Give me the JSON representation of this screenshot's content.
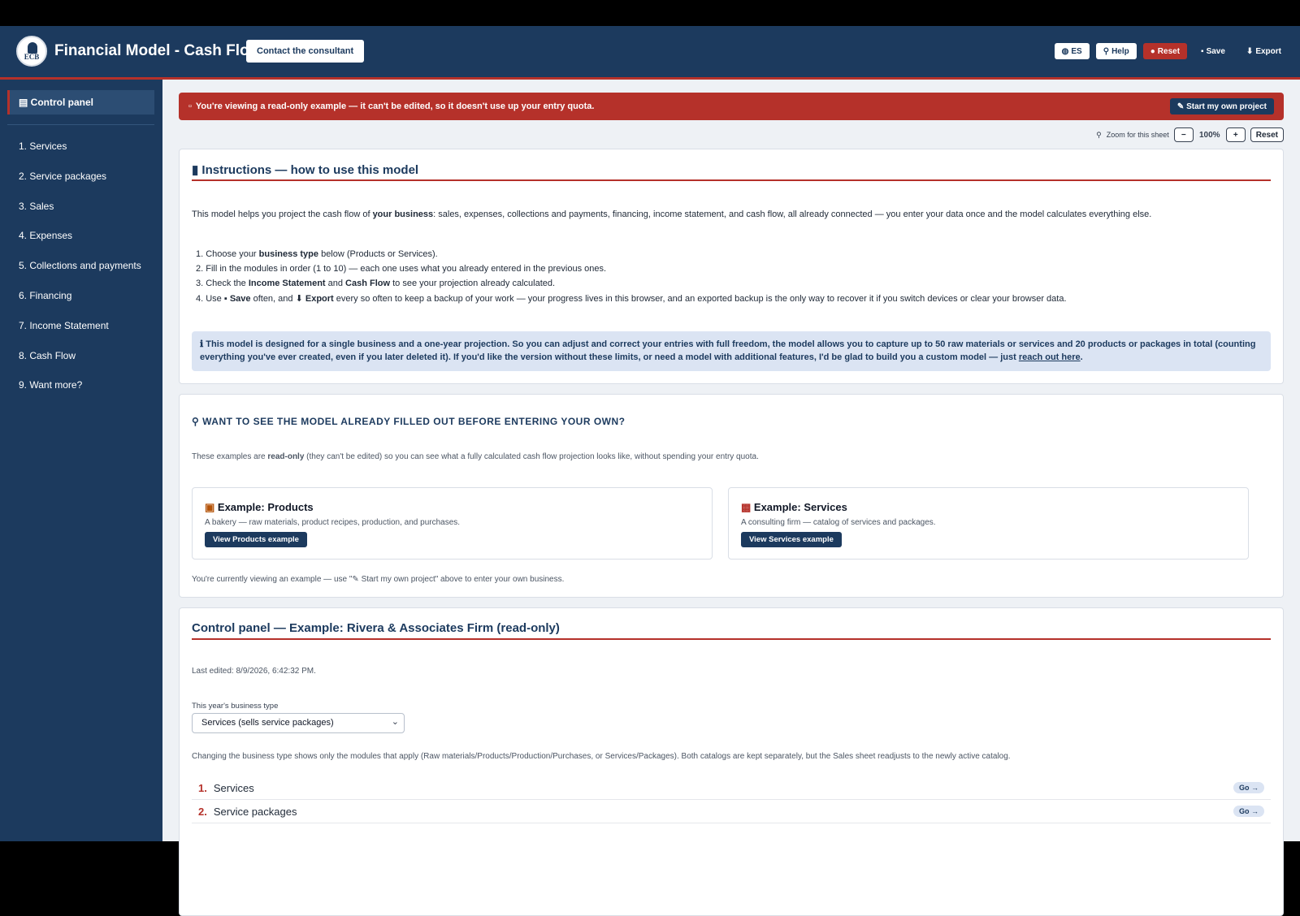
{
  "header": {
    "title": "Financial Model - Cash Flow",
    "logo_text": "ECB",
    "consult_label": "Contact the consultant",
    "lang_label": "ES",
    "help_label": "Help",
    "reset_label": "Reset",
    "save_label": "Save",
    "export_label": "Export"
  },
  "sidebar": {
    "active": "Control panel",
    "items": [
      {
        "label": "1. Services"
      },
      {
        "label": "2. Service packages"
      },
      {
        "label": "3. Sales"
      },
      {
        "label": "4. Expenses"
      },
      {
        "label": "5. Collections and payments"
      },
      {
        "label": "6. Financing"
      },
      {
        "label": "7. Income Statement"
      },
      {
        "label": "8. Cash Flow"
      },
      {
        "label": "9. Want more?"
      }
    ]
  },
  "banner": {
    "text": "You're viewing a read-only example — it can't be edited, so it doesn't use up your entry quota.",
    "start_label": "Start my own project"
  },
  "zoom": {
    "label": "Zoom for this sheet",
    "minus": "−",
    "value": "100%",
    "plus": "+",
    "reset": "Reset"
  },
  "instructions": {
    "title": "Instructions — how to use this model",
    "intro_1": "This model helps you project the cash flow of ",
    "intro_bold": "your business",
    "intro_2": ": sales, expenses, collections and payments, financing, income statement, and cash flow, all already connected — you enter your data once and the model calculates everything else.",
    "s1_a": "1. Choose your ",
    "s1_b": "business type",
    "s1_c": " below (Products or Services).",
    "s2": "2. Fill in the modules in order (1 to 10) — each one uses what you already entered in the previous ones.",
    "s3_a": "3. Check the ",
    "s3_b": "Income Statement",
    "s3_c": " and ",
    "s3_d": "Cash Flow",
    "s3_e": " to see your projection already calculated.",
    "s4_a": "4. Use ",
    "s4_b": "Save",
    "s4_c": " often, and ",
    "s4_d": "Export",
    "s4_e": " every so often to keep a backup of your work — your progress lives in this browser, and an exported backup is the only way to recover it if you switch devices or clear your browser data.",
    "info_1": "This model is designed for a single business and a one-year projection. So you can adjust and correct your entries with full freedom, the model allows you to capture up to 50 raw materials or services and 20 products or packages in total (counting everything you've ever created, even if you later deleted it). If you'd like the version without these limits, or need a model with additional features, I'd be glad to build you a custom model — just ",
    "info_link": "reach out here",
    "info_end": "."
  },
  "examples": {
    "title": "WANT TO SEE THE MODEL ALREADY FILLED OUT BEFORE ENTERING YOUR OWN?",
    "desc_1": "These examples are ",
    "desc_bold": "read-only",
    "desc_2": " (they can't be edited) so you can see what a fully calculated cash flow projection looks like, without spending your entry quota.",
    "products": {
      "title": "Example: Products",
      "desc": "A bakery — raw materials, product recipes, production, and purchases.",
      "button": "View Products example"
    },
    "services": {
      "title": "Example: Services",
      "desc": "A consulting firm — catalog of services and packages.",
      "button": "View Services example"
    },
    "note_1": "You're currently viewing an example — use \"",
    "note_2": " Start my own project\" above to enter your own business."
  },
  "control": {
    "title": "Control panel — Example: Rivera & Associates Firm (read-only)",
    "last_edited": "Last edited: 8/9/2026, 6:42:32 PM.",
    "type_label": "This year's business type",
    "type_value": "Services (sells service packages)",
    "type_note": "Changing the business type shows only the modules that apply (Raw materials/Products/Production/Purchases, or Services/Packages). Both catalogs are kept separately, but the Sales sheet readjusts to the newly active catalog.",
    "modules": [
      {
        "num": "1.",
        "label": "Services",
        "go": "Go →"
      },
      {
        "num": "2.",
        "label": "Service packages",
        "go": "Go →"
      }
    ]
  },
  "colors": {
    "navy": "#1c3a5e",
    "accent_red": "#b5312a",
    "info_bg": "#dbe4f3"
  }
}
